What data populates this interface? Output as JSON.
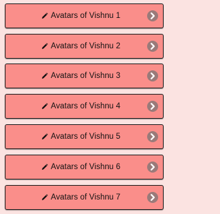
{
  "items": [
    {
      "label": "Avatars of Vishnu 1",
      "icon": "pencil-icon",
      "action_icon": "chevron-right-icon"
    },
    {
      "label": "Avatars of Vishnu 2",
      "icon": "pencil-icon",
      "action_icon": "chevron-right-icon"
    },
    {
      "label": "Avatars of Vishnu 3",
      "icon": "pencil-icon",
      "action_icon": "chevron-right-icon"
    },
    {
      "label": "Avatars of Vishnu 4",
      "icon": "pencil-icon",
      "action_icon": "chevron-right-icon"
    },
    {
      "label": "Avatars of Vishnu 5",
      "icon": "pencil-icon",
      "action_icon": "chevron-right-icon"
    },
    {
      "label": "Avatars of Vishnu 6",
      "icon": "pencil-icon",
      "action_icon": "chevron-right-icon"
    },
    {
      "label": "Avatars of Vishnu 7",
      "icon": "pencil-icon",
      "action_icon": "chevron-right-icon"
    }
  ],
  "colors": {
    "page_background": "#fbe3e1",
    "item_background": "#fa8e8a",
    "item_border": "#1b1b1b",
    "chevron_circle": "#9a7a79",
    "chevron_arrow": "#ffffff"
  }
}
